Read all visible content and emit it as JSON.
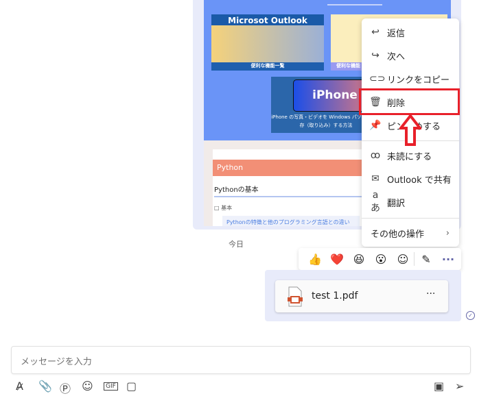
{
  "cards": {
    "outlook_title": "Microsot Outlook",
    "outlook_caption": "便利な機能一覧",
    "second_caption": "便利な機能",
    "iphone_title": "iPhone",
    "iphone_caption": "iPhone の写真・ビデオを Windows パソコンに保存（取り込み）する方法"
  },
  "python": {
    "header": "Python",
    "subtitle": "Pythonの基本",
    "item": "基本",
    "link": "Pythonの特徴と他のプログラミング言語との違い"
  },
  "menu": {
    "items": [
      {
        "icon": "reply-icon",
        "label": "返信"
      },
      {
        "icon": "forward-icon",
        "label": "次へ"
      },
      {
        "icon": "link-icon",
        "label": "リンクをコピー"
      },
      {
        "icon": "trash-icon",
        "label": "削除"
      },
      {
        "icon": "pin-icon",
        "label": "ピン留めする"
      },
      {
        "icon": "unread-icon",
        "label": "未読にする"
      },
      {
        "icon": "mail-icon",
        "label": "Outlook で共有"
      },
      {
        "icon": "translate-icon",
        "label": "翻訳"
      },
      {
        "icon": "chevron-right-icon",
        "label": "その他の操作"
      }
    ]
  },
  "highlight_color": "#e8202a",
  "date_divider": "今日",
  "reactions": [
    "👍",
    "❤️",
    "😆",
    "😮"
  ],
  "file": {
    "name": "test 1.pdf",
    "more": "···"
  },
  "compose": {
    "placeholder": "メッセージを入力"
  }
}
